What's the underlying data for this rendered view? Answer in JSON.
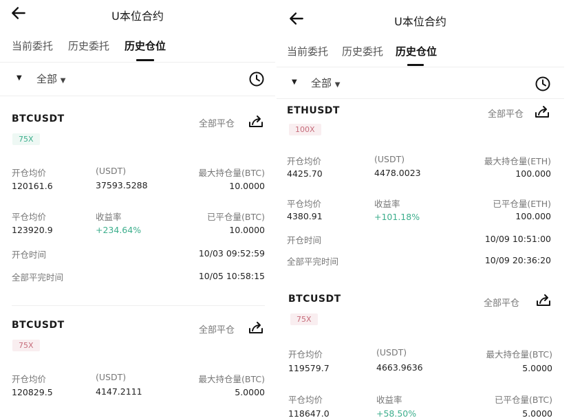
{
  "header": {
    "title": "U本位合约"
  },
  "tabs": [
    "当前委托",
    "历史委托",
    "历史仓位"
  ],
  "filter": {
    "all_label": "全部"
  },
  "close_all_label": "全部平仓",
  "left_cards": [
    {
      "symbol": "BTCUSDT",
      "leverage": "75X",
      "open_avg_label": "开仓均价",
      "open_avg": "120161.6",
      "usdt_label": "(USDT)",
      "usdt": "37593.5288",
      "max_hold_label": "最大持仓量(BTC)",
      "max_hold": "10.0000",
      "close_avg_label": "平仓均价",
      "close_avg": "123920.9",
      "yield_label": "收益率",
      "yield": "+234.64%",
      "closed_label": "已平仓量(BTC)",
      "closed": "10.0000",
      "open_time_label": "开仓时间",
      "open_time": "10/03 09:52:59",
      "close_time_label": "全部平完时间",
      "close_time": "10/05 10:58:15"
    },
    {
      "symbol": "BTCUSDT",
      "leverage": "75X",
      "open_avg_label": "开仓均价",
      "open_avg": "120829.5",
      "usdt_label": "(USDT)",
      "usdt": "4147.2111",
      "max_hold_label": "最大持仓量(BTC)",
      "max_hold": "5.0000"
    }
  ],
  "right_cards": [
    {
      "symbol": "ETHUSDT",
      "leverage": "100X",
      "open_avg_label": "开仓均价",
      "open_avg": "4425.70",
      "usdt_label": "(USDT)",
      "usdt": "4478.0023",
      "max_hold_label": "最大持仓量(ETH)",
      "max_hold": "100.000",
      "close_avg_label": "平仓均价",
      "close_avg": "4380.91",
      "yield_label": "收益率",
      "yield": "+101.18%",
      "closed_label": "已平仓量(ETH)",
      "closed": "100.000",
      "open_time_label": "开仓时间",
      "open_time": "10/09 10:51:00",
      "close_time_label": "全部平完时间",
      "close_time": "10/09 20:36:20"
    },
    {
      "symbol": "BTCUSDT",
      "leverage": "75X",
      "open_avg_label": "开仓均价",
      "open_avg": "119579.7",
      "usdt_label": "(USDT)",
      "usdt": "4663.9636",
      "max_hold_label": "最大持仓量(BTC)",
      "max_hold": "5.0000",
      "close_avg_label": "平仓均价",
      "close_avg": "118647.0",
      "yield_label": "收益率",
      "yield": "+58.50%",
      "closed_label": "已平仓量(BTC)",
      "closed": "5.0000"
    }
  ]
}
